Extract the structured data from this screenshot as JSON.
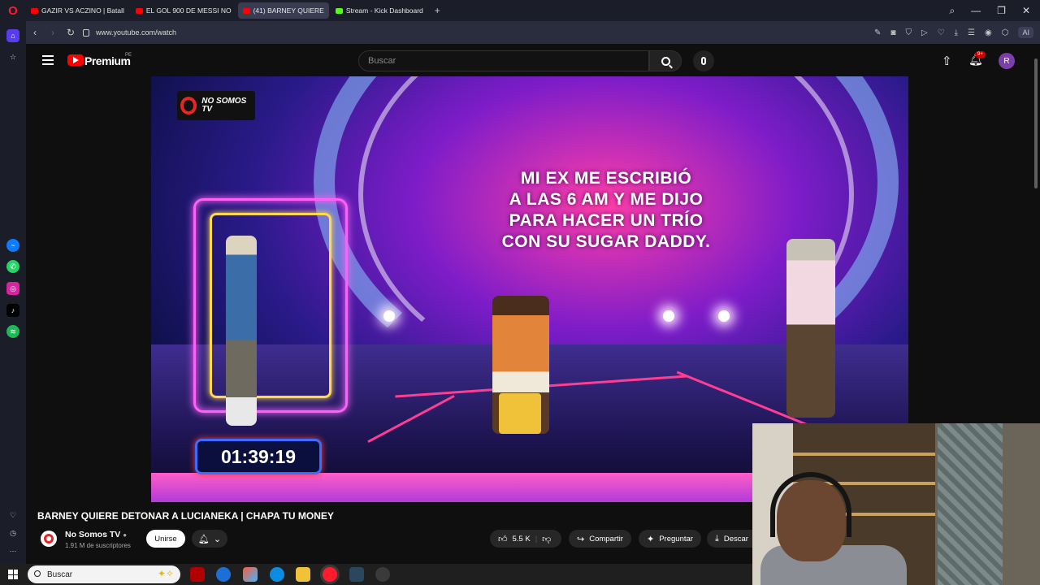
{
  "browser": {
    "tabs": [
      {
        "label": "GAZIR VS ACZINO | Batall",
        "type": "youtube"
      },
      {
        "label": "EL GOL 900 DE MESSI NO",
        "type": "youtube"
      },
      {
        "label": "(41) BARNEY QUIERE",
        "type": "youtube",
        "active": true
      },
      {
        "label": "Stream - Kick Dashboard",
        "type": "kick"
      }
    ],
    "new_tab_label": "+",
    "url": "www.youtube.com/watch",
    "ai_label": "AI"
  },
  "youtube": {
    "brand": "Premium",
    "country_code": "PE",
    "search_placeholder": "Buscar",
    "notification_count": "9+",
    "avatar_letter": "R",
    "video_overlay": {
      "logo_text": "NO SOMOS TV",
      "caption_lines": [
        "MI EX ME ESCRIBIÓ",
        "A LAS 6 AM Y ME DIJO",
        "PARA HACER UN TRÍO",
        "CON SU SUGAR DADDY."
      ],
      "timer": "01:39:19"
    },
    "video_title": "BARNEY QUIERE DETONAR A LUCIANEKA | CHAPA TU MONEY",
    "channel": {
      "name": "No Somos TV",
      "subscribers": "1.91 M de suscriptores",
      "join_label": "Unirse"
    },
    "actions": {
      "likes": "5.5 K",
      "share_label": "Compartir",
      "ask_label": "Preguntar",
      "download_label": "Descar"
    }
  },
  "taskbar": {
    "search_placeholder": "Buscar"
  },
  "colors": {
    "youtube_red": "#ff0000",
    "opera_red": "#ff1b2d",
    "kick_green": "#53fc18"
  }
}
